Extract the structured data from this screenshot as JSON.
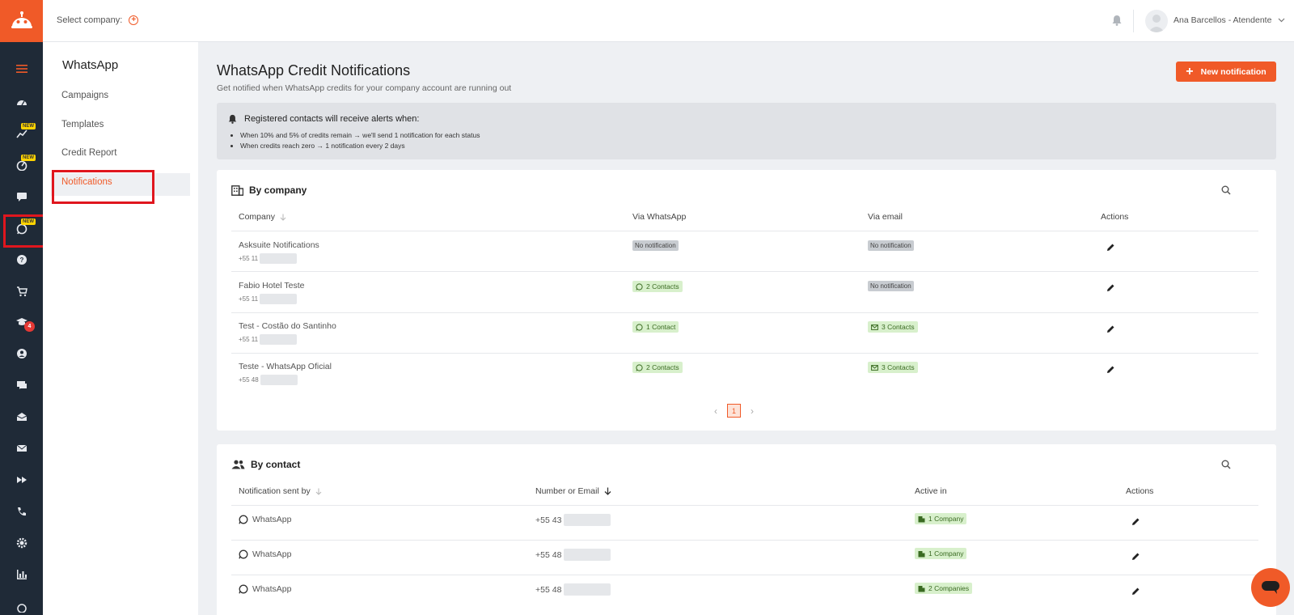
{
  "topbar": {
    "select_company_label": "Select company:",
    "user_name": "Ana Barcellos - Atendente"
  },
  "rail": {
    "new_badge": "NEW",
    "academy_count": "4"
  },
  "subnav": {
    "title": "WhatsApp",
    "items": [
      {
        "label": "Campaigns"
      },
      {
        "label": "Templates"
      },
      {
        "label": "Credit Report"
      },
      {
        "label": "Notifications"
      }
    ]
  },
  "page": {
    "title": "WhatsApp Credit Notifications",
    "subtitle": "Get notified when WhatsApp credits for your company account are running out",
    "new_button": "New notification"
  },
  "alert": {
    "heading": "Registered contacts will receive alerts when:",
    "bullets": [
      "When 10% and 5% of credits remain → we'll send 1 notification for each status",
      "When credits reach zero → 1 notification every 2 days"
    ]
  },
  "by_company": {
    "title": "By company",
    "headers": {
      "company": "Company",
      "via_whatsapp": "Via WhatsApp",
      "via_email": "Via email",
      "actions": "Actions"
    },
    "rows": [
      {
        "name": "Asksuite Notifications",
        "phone": "+55 11",
        "whatsapp": "No notification",
        "email": "No notification"
      },
      {
        "name": "Fabio Hotel Teste",
        "phone": "+55 11",
        "whatsapp": "2 Contacts",
        "email": "No notification"
      },
      {
        "name": "Test - Costão do Santinho",
        "phone": "+55 11",
        "whatsapp": "1 Contact",
        "email": "3 Contacts"
      },
      {
        "name": "Teste - WhatsApp Oficial",
        "phone": "+55 48",
        "whatsapp": "2 Contacts",
        "email": "3 Contacts"
      }
    ],
    "current_page": "1"
  },
  "by_contact": {
    "title": "By contact",
    "headers": {
      "sent_by": "Notification sent by",
      "number_or_email": "Number or Email",
      "active_in": "Active in",
      "actions": "Actions"
    },
    "rows": [
      {
        "sent_by": "WhatsApp",
        "number": "+55 43",
        "active_in": "1 Company"
      },
      {
        "sent_by": "WhatsApp",
        "number": "+55 48",
        "active_in": "1 Company"
      },
      {
        "sent_by": "WhatsApp",
        "number": "+55 48",
        "active_in": "2 Companies"
      }
    ]
  },
  "colors": {
    "accent": "#f05a28",
    "rail": "#1f2a37",
    "highlight": "#e0161e"
  }
}
